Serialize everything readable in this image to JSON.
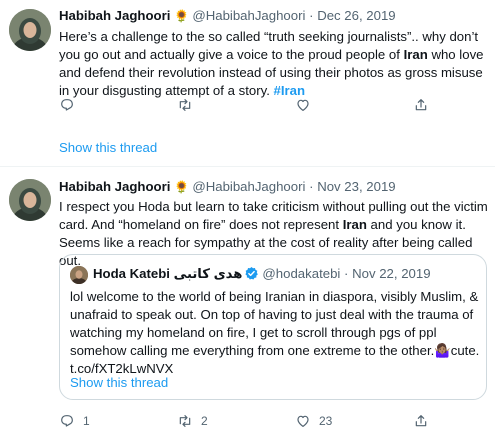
{
  "tweets": [
    {
      "author_name": "Habibah Jaghoori",
      "emoji": "🌻",
      "handle": "@HabibahJaghoori",
      "separator": "·",
      "date": "Dec 26, 2019",
      "text_parts": [
        "Here’s a challenge to the so called “truth seeking journalists”.. why don’t you go out and actually give a voice to the proud people of ",
        "Iran",
        " who love and defend their revolution instead of using their photos as gross misuse in your disgusting attempt of a story. ",
        "#Iran"
      ],
      "show_thread": "Show this thread"
    },
    {
      "author_name": "Habibah Jaghoori",
      "emoji": "🌻",
      "handle": "@HabibahJaghoori",
      "separator": "·",
      "date": "Nov 23, 2019",
      "text_parts": [
        "I respect you Hoda but learn to take criticism without pulling out the victim card. And “homeland on fire” does not represent ",
        "Iran",
        " and you know it. Seems like a reach for sympathy at the cost of reality after being called out."
      ],
      "quote": {
        "author_name": "Hoda Katebi هدی کاتبی",
        "handle": "@hodakatebi",
        "separator": "·",
        "date": "Nov 22, 2019",
        "text": "lol welcome to the world of being Iranian in diaspora, visibly Muslim, & unafraid to speak out. On top of having to just deal with the trauma of watching my homeland on fire, I get to scroll through pgs of ppl somehow calling me everything from one extreme to the other.",
        "emoji": "🤷🏽‍♀️",
        "text_end": "cute.",
        "link": "t.co/fXT2kLwNVX",
        "show_thread": "Show this thread"
      },
      "reply_count": "1",
      "retweet_count": "2",
      "like_count": "23"
    }
  ],
  "colors": {
    "accent": "#1d9bf0",
    "secondary_text": "#536471",
    "border": "#cfd9de",
    "divider": "#eff3f4"
  },
  "icons": [
    "reply-icon",
    "retweet-icon",
    "like-icon",
    "share-icon",
    "verified-badge-icon"
  ]
}
